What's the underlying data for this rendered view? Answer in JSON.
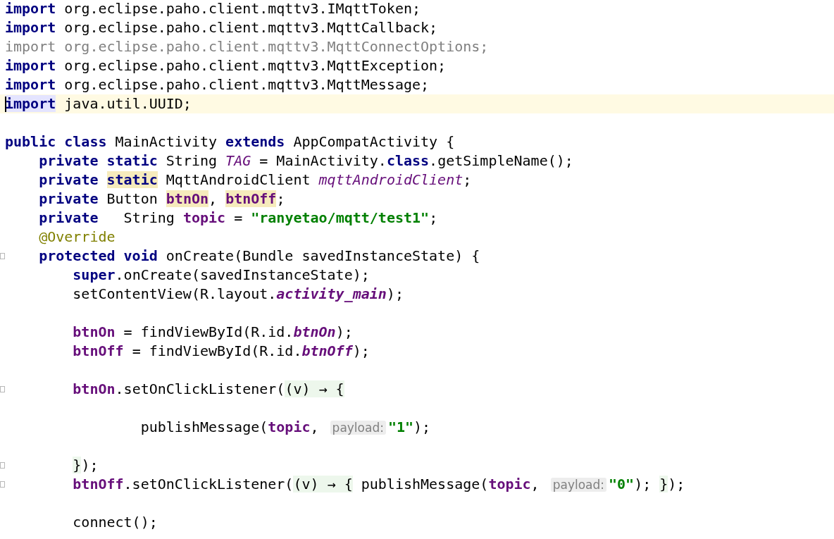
{
  "editor": {
    "lines": [
      {
        "current": false,
        "fold": false,
        "tokens": [
          {
            "kind": "keyword",
            "text": "import"
          },
          {
            "kind": "plain",
            "text": " org.eclipse.paho.client.mqttv3.IMqttToken;"
          }
        ]
      },
      {
        "current": false,
        "fold": false,
        "tokens": [
          {
            "kind": "keyword",
            "text": "import"
          },
          {
            "kind": "plain",
            "text": " org.eclipse.paho.client.mqttv3.MqttCallback;"
          }
        ]
      },
      {
        "current": false,
        "fold": false,
        "tokens": [
          {
            "kind": "unused",
            "text": "import org.eclipse.paho.client.mqttv3.MqttConnectOptions;"
          }
        ]
      },
      {
        "current": false,
        "fold": false,
        "tokens": [
          {
            "kind": "keyword",
            "text": "import"
          },
          {
            "kind": "plain",
            "text": " org.eclipse.paho.client.mqttv3.MqttException;"
          }
        ]
      },
      {
        "current": false,
        "fold": false,
        "tokens": [
          {
            "kind": "keyword",
            "text": "import"
          },
          {
            "kind": "plain",
            "text": " org.eclipse.paho.client.mqttv3.MqttMessage;"
          }
        ]
      },
      {
        "current": true,
        "fold": false,
        "tokens": [
          {
            "kind": "keyword-caret",
            "text": "import"
          },
          {
            "kind": "plain",
            "text": " java.util.UUID;"
          }
        ]
      },
      {
        "current": false,
        "fold": false
      },
      {
        "current": false,
        "fold": false,
        "tokens": [
          {
            "kind": "keyword",
            "text": "public class"
          },
          {
            "kind": "plain",
            "text": " MainActivity "
          },
          {
            "kind": "keyword",
            "text": "extends"
          },
          {
            "kind": "plain",
            "text": " AppCompatActivity {"
          }
        ]
      },
      {
        "current": false,
        "fold": false,
        "tokens": [
          {
            "kind": "keyword",
            "text": "    private static"
          },
          {
            "kind": "plain",
            "text": " String "
          },
          {
            "kind": "static",
            "text": "TAG"
          },
          {
            "kind": "plain",
            "text": " = MainActivity."
          },
          {
            "kind": "keyword",
            "text": "class"
          },
          {
            "kind": "plain",
            "text": ".getSimpleName();"
          }
        ]
      },
      {
        "current": false,
        "fold": false,
        "tokens": [
          {
            "kind": "keyword",
            "text": "    private "
          },
          {
            "kind": "keyword-usage",
            "text": "static"
          },
          {
            "kind": "plain",
            "text": " MqttAndroidClient "
          },
          {
            "kind": "static",
            "text": "mqttAndroidClient"
          },
          {
            "kind": "plain",
            "text": ";"
          }
        ]
      },
      {
        "current": false,
        "fold": false,
        "tokens": [
          {
            "kind": "keyword",
            "text": "    private"
          },
          {
            "kind": "plain",
            "text": " Button "
          },
          {
            "kind": "field-usage",
            "text": "btnOn"
          },
          {
            "kind": "plain",
            "text": ", "
          },
          {
            "kind": "field-usage",
            "text": "btnOff"
          },
          {
            "kind": "plain",
            "text": ";"
          }
        ]
      },
      {
        "current": false,
        "fold": false,
        "tokens": [
          {
            "kind": "keyword",
            "text": "    private"
          },
          {
            "kind": "plain",
            "text": "   String "
          },
          {
            "kind": "field",
            "text": "topic"
          },
          {
            "kind": "plain",
            "text": " = "
          },
          {
            "kind": "string",
            "text": "\"ranyetao/mqtt/test1\""
          },
          {
            "kind": "plain",
            "text": ";"
          }
        ]
      },
      {
        "current": false,
        "fold": false,
        "tokens": [
          {
            "kind": "annotation",
            "text": "    @Override"
          }
        ]
      },
      {
        "current": false,
        "fold": true,
        "tokens": [
          {
            "kind": "keyword",
            "text": "    protected void"
          },
          {
            "kind": "plain",
            "text": " onCreate(Bundle savedInstanceState) {"
          }
        ]
      },
      {
        "current": false,
        "fold": false,
        "tokens": [
          {
            "kind": "keyword",
            "text": "        super"
          },
          {
            "kind": "plain",
            "text": ".onCreate(savedInstanceState);"
          }
        ]
      },
      {
        "current": false,
        "fold": false,
        "tokens": [
          {
            "kind": "plain",
            "text": "        setContentView(R.layout."
          },
          {
            "kind": "static-bold",
            "text": "activity_main"
          },
          {
            "kind": "plain",
            "text": ");"
          }
        ]
      },
      {
        "current": false,
        "fold": false
      },
      {
        "current": false,
        "fold": false,
        "tokens": [
          {
            "kind": "field",
            "text": "        btnOn"
          },
          {
            "kind": "plain",
            "text": " = findViewById(R.id."
          },
          {
            "kind": "static-bold",
            "text": "btnOn"
          },
          {
            "kind": "plain",
            "text": ");"
          }
        ]
      },
      {
        "current": false,
        "fold": false,
        "tokens": [
          {
            "kind": "field",
            "text": "        btnOff"
          },
          {
            "kind": "plain",
            "text": " = findViewById(R.id."
          },
          {
            "kind": "static-bold",
            "text": "btnOff"
          },
          {
            "kind": "plain",
            "text": ");"
          }
        ]
      },
      {
        "current": false,
        "fold": false
      },
      {
        "current": false,
        "fold": true,
        "tokens": [
          {
            "kind": "field",
            "text": "        btnOn"
          },
          {
            "kind": "plain",
            "text": ".setOnClickListener("
          },
          {
            "kind": "lambda",
            "text": "(v) → {"
          }
        ]
      },
      {
        "current": false,
        "fold": false
      },
      {
        "current": false,
        "fold": false,
        "tokens": [
          {
            "kind": "plain",
            "text": "                publishMessage("
          },
          {
            "kind": "field",
            "text": "topic"
          },
          {
            "kind": "plain",
            "text": ", "
          },
          {
            "kind": "hint",
            "text": "payload:"
          },
          {
            "kind": "string",
            "text": "\"1\""
          },
          {
            "kind": "plain",
            "text": ");"
          }
        ]
      },
      {
        "current": false,
        "fold": false
      },
      {
        "current": false,
        "fold": true,
        "tokens": [
          {
            "kind": "lambda",
            "text": "        }"
          },
          {
            "kind": "plain",
            "text": ");"
          }
        ]
      },
      {
        "current": false,
        "fold": true,
        "tokens": [
          {
            "kind": "field",
            "text": "        btnOff"
          },
          {
            "kind": "plain",
            "text": ".setOnClickListener("
          },
          {
            "kind": "lambda",
            "text": "(v) → {"
          },
          {
            "kind": "plain",
            "text": " publishMessage("
          },
          {
            "kind": "field",
            "text": "topic"
          },
          {
            "kind": "plain",
            "text": ", "
          },
          {
            "kind": "hint",
            "text": "payload:"
          },
          {
            "kind": "string",
            "text": "\"0\""
          },
          {
            "kind": "plain",
            "text": "); "
          },
          {
            "kind": "lambda",
            "text": "}"
          },
          {
            "kind": "plain",
            "text": ");"
          }
        ]
      },
      {
        "current": false,
        "fold": false
      },
      {
        "current": false,
        "fold": false,
        "tokens": [
          {
            "kind": "plain",
            "text": "        connect();"
          }
        ]
      }
    ]
  }
}
